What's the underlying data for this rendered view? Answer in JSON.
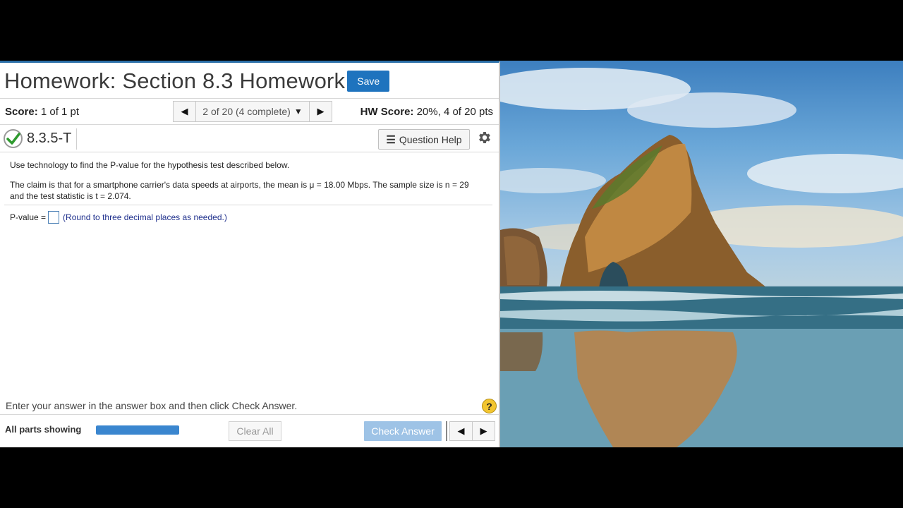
{
  "header": {
    "title": "Homework: Section 8.3 Homework",
    "save_label": "Save"
  },
  "score_bar": {
    "score_label": "Score:",
    "score_value": "1 of 1 pt",
    "nav_position": "2 of 20 (4 complete)",
    "hw_score_label": "HW Score:",
    "hw_score_value": "20%, 4 of 20 pts"
  },
  "question": {
    "id": "8.3.5-T",
    "status_icon": "checkmark-icon",
    "help_label": "Question Help",
    "instructions": "Use technology to find the P-value for the hypothesis test described below.",
    "claim_line1": "The claim is that for a smartphone carrier's data speeds at airports, the mean is μ = 18.00 Mbps. The sample size is n = 29",
    "claim_line2": "and the test statistic is t = 2.074.",
    "answer_label": "P-value =",
    "answer_value": "",
    "answer_hint": "(Round to three decimal places as needed.)"
  },
  "footer": {
    "enter_message": "Enter your answer in the answer box and then click Check Answer.",
    "help_symbol": "?",
    "all_parts_label": "All parts showing",
    "progress_fraction": 1.0,
    "clear_all_label": "Clear All",
    "check_answer_label": "Check Answer"
  },
  "colors": {
    "accent": "#1e73be",
    "check_answer_disabled": "#9ec3e6",
    "check_green": "#2e9a2e"
  }
}
